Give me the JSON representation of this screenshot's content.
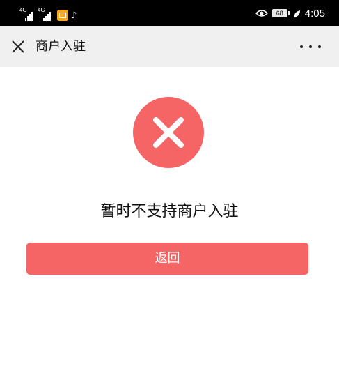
{
  "status_bar": {
    "network_1": "4G",
    "network_2": "4G",
    "battery_level": "68",
    "time": "4:05",
    "icons": [
      "signal-icon",
      "signal-icon",
      "mail-app-icon",
      "tiktok-app-icon",
      "eye-icon",
      "battery-icon",
      "leaf-icon"
    ]
  },
  "nav": {
    "title": "商户入驻",
    "close_icon": "close-icon",
    "more_icon": "more-icon"
  },
  "result": {
    "icon": "error-icon",
    "message": "暂时不支持商户入驻",
    "back_label": "返回"
  },
  "colors": {
    "accent": "#f56565",
    "nav_background": "#f0f0f0",
    "status_bar": "#000000"
  }
}
